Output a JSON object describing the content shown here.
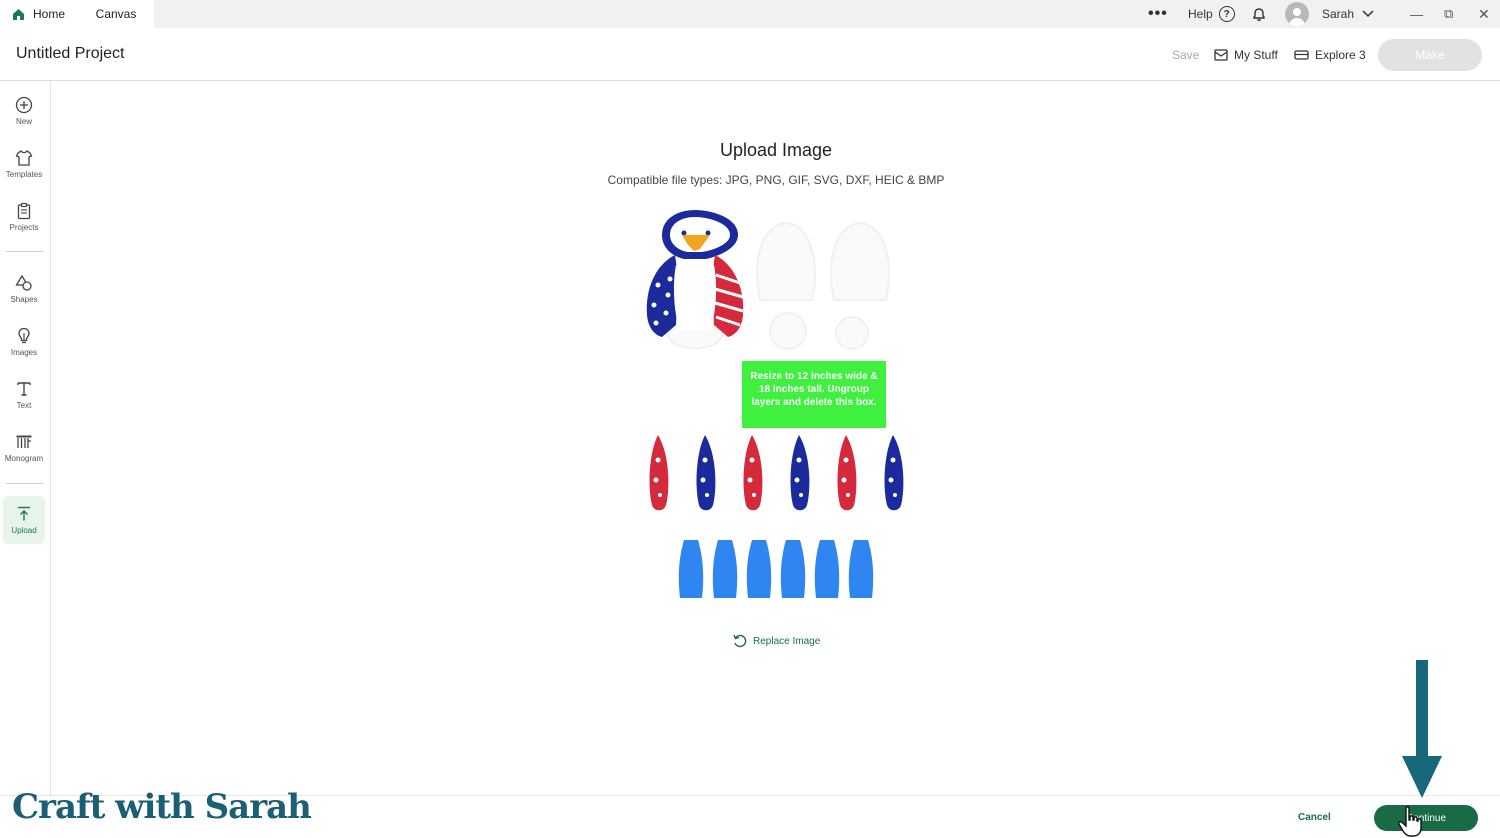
{
  "tabs": {
    "home": "Home",
    "canvas": "Canvas"
  },
  "topbar": {
    "more": "•••",
    "help": "Help",
    "help_glyph": "?",
    "user_name": "Sarah",
    "win_min": "—",
    "win_max": "⧉",
    "win_close": "✕"
  },
  "header": {
    "title": "Untitled Project",
    "save": "Save",
    "my_stuff": "My Stuff",
    "machine": "Explore 3",
    "make": "Make"
  },
  "sidebar": {
    "items": [
      {
        "label": "New",
        "icon": "plus-circle-icon"
      },
      {
        "label": "Templates",
        "icon": "shirt-icon"
      },
      {
        "label": "Projects",
        "icon": "clipboard-icon"
      },
      {
        "label": "Shapes",
        "icon": "shapes-icon"
      },
      {
        "label": "Images",
        "icon": "lightbulb-icon"
      },
      {
        "label": "Text",
        "icon": "text-icon"
      },
      {
        "label": "Monogram",
        "icon": "monogram-icon"
      },
      {
        "label": "Upload",
        "icon": "upload-icon"
      }
    ],
    "active": "Upload"
  },
  "main": {
    "title": "Upload Image",
    "file_types": "Compatible file types:  JPG, PNG, GIF, SVG, DXF, HEIC & BMP",
    "design_note": "Resize to 12 inches wide & 18 inches tall. Ungroup layers and delete this box.",
    "replace_image": "Replace Image"
  },
  "footer": {
    "cancel": "Cancel",
    "continue": "Continue",
    "watermark": "Craft with Sarah"
  },
  "colors": {
    "accent_green": "#196b45",
    "design_red": "#d42a3c",
    "design_navy": "#1c2a9c",
    "design_blue": "#2f86f0",
    "note_green": "#3ff03f",
    "arrow_teal": "#16687a"
  }
}
